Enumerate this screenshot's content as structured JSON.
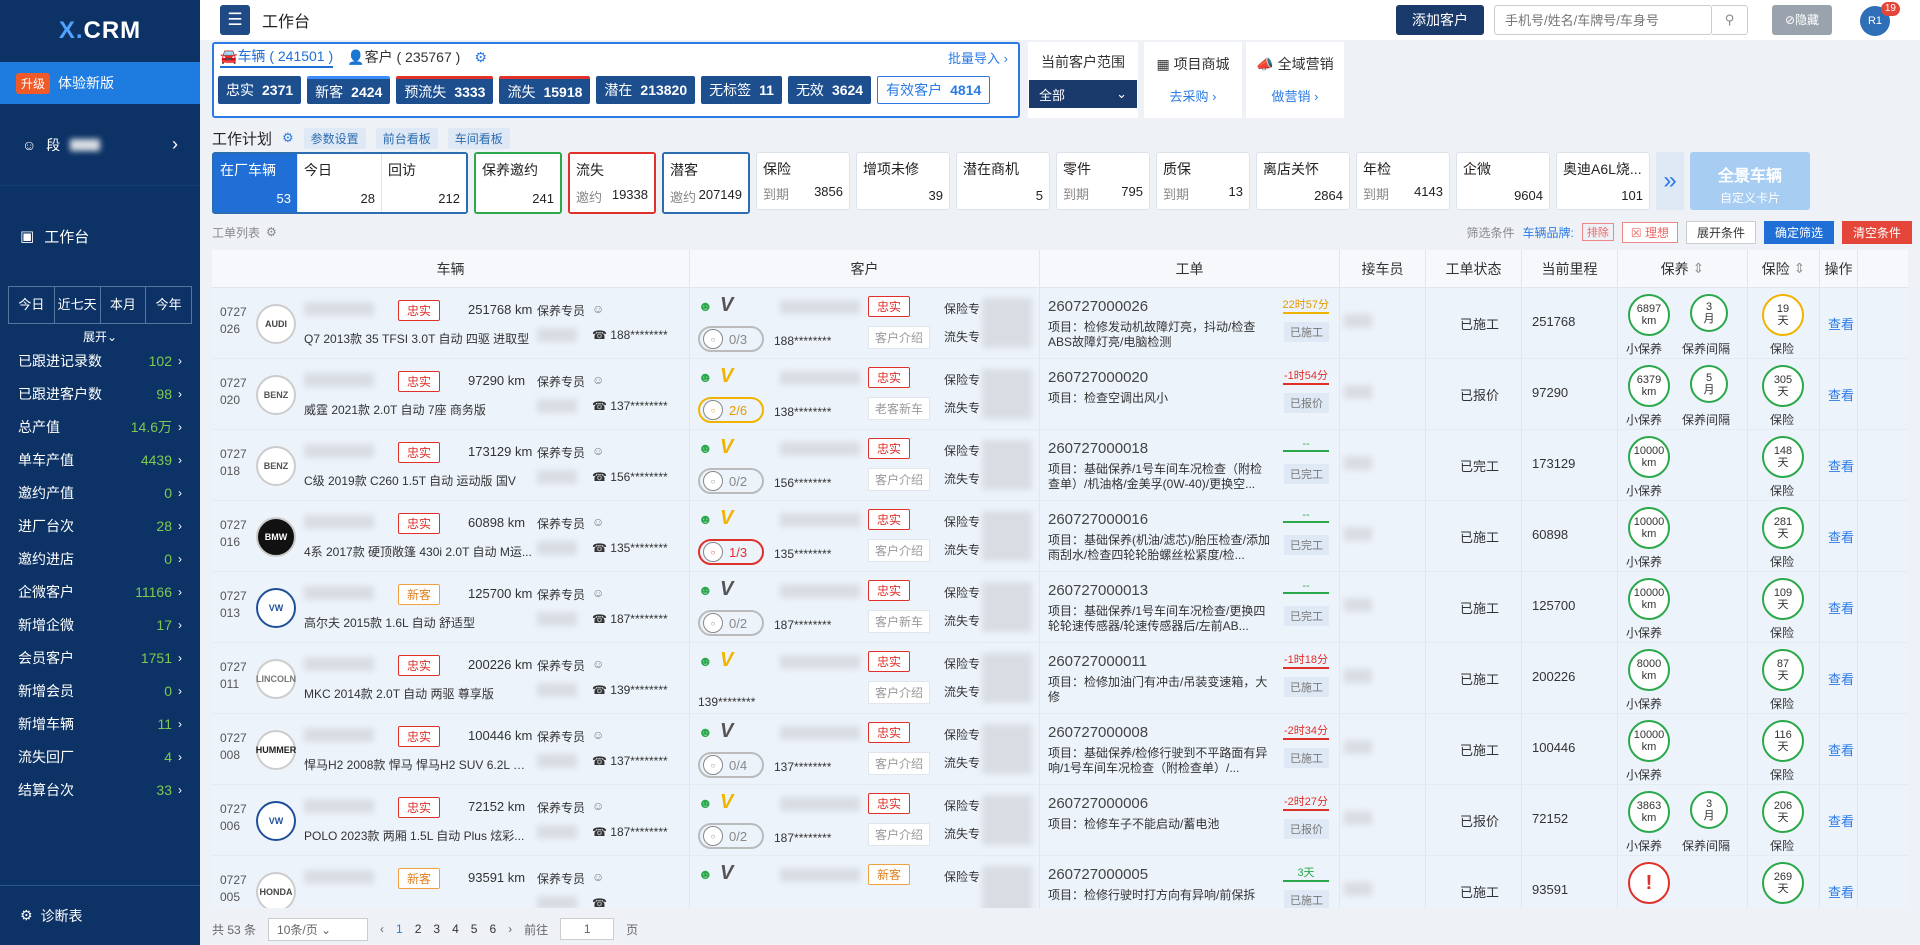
{
  "sidebar": {
    "logo_a": "X.",
    "logo_b": "CRM",
    "upgrade_tag": "升级",
    "upgrade_label": "体验新版",
    "user_name": "段",
    "workbench": "工作台",
    "periods": [
      "今日",
      "近七天",
      "本月",
      "今年"
    ],
    "expand": "展开",
    "stats": [
      {
        "label": "已跟进记录数",
        "value": "102"
      },
      {
        "label": "已跟进客户数",
        "value": "98"
      },
      {
        "label": "总产值",
        "value": "14.6万"
      },
      {
        "label": "单车产值",
        "value": "4439"
      },
      {
        "label": "邀约产值",
        "value": "0"
      },
      {
        "label": "进厂台次",
        "value": "28"
      },
      {
        "label": "邀约进店",
        "value": "0"
      },
      {
        "label": "企微客户",
        "value": "11166"
      },
      {
        "label": "新增企微",
        "value": "17"
      },
      {
        "label": "会员客户",
        "value": "1751"
      },
      {
        "label": "新增会员",
        "value": "0"
      },
      {
        "label": "新增车辆",
        "value": "11"
      },
      {
        "label": "流失回厂",
        "value": "4"
      },
      {
        "label": "结算台次",
        "value": "33"
      }
    ],
    "diagnose": "诊断表"
  },
  "header": {
    "title": "工作台",
    "add_customer": "添加客户",
    "search_placeholder": "手机号/姓名/车牌号/车身号",
    "hide": "隐藏",
    "avatar_text": "R1",
    "badge": "19"
  },
  "top_panel": {
    "tab_vehicle": "车辆 ( 241501 )",
    "tab_customer": "客户 ( 235767 )",
    "batch_import": "批量导入",
    "buttons": [
      {
        "label": "忠实",
        "value": "2371",
        "accent": "none"
      },
      {
        "label": "新客",
        "value": "2424",
        "accent": "blue"
      },
      {
        "label": "预流失",
        "value": "3333",
        "accent": "red"
      },
      {
        "label": "流失",
        "value": "15918",
        "accent": "red"
      },
      {
        "label": "潜在",
        "value": "213820",
        "accent": "none"
      },
      {
        "label": "无标签",
        "value": "11",
        "accent": "none"
      },
      {
        "label": "无效",
        "value": "3624",
        "accent": "none"
      }
    ],
    "valid_label": "有效客户",
    "valid_value": "4814"
  },
  "scope": {
    "title": "当前客户范围",
    "value": "全部"
  },
  "mall": {
    "title": "项目商城",
    "link": "去采购"
  },
  "marketing": {
    "title": "全域营销",
    "link": "做营销"
  },
  "workplan": {
    "title": "工作计划",
    "tags": [
      "参数设置",
      "前台看板",
      "车间看板"
    ]
  },
  "card_groups": [
    {
      "color": "blue",
      "cards": [
        {
          "title": "在厂车辆",
          "sub": "",
          "value": "53",
          "selected": true
        },
        {
          "title": "今日",
          "sub": "",
          "value": "28"
        },
        {
          "title": "回访",
          "sub": "",
          "value": "212"
        }
      ]
    },
    {
      "color": "green",
      "cards": [
        {
          "title": "保养邀约",
          "sub": "",
          "value": "241"
        }
      ]
    },
    {
      "color": "red",
      "cards": [
        {
          "title": "流失",
          "sub": "邀约",
          "value": "19338"
        }
      ]
    },
    {
      "color": "blue",
      "cards": [
        {
          "title": "潜客",
          "sub": "邀约",
          "value": "207149"
        }
      ]
    }
  ],
  "plain_cards": [
    {
      "title": "保险",
      "sub": "到期",
      "value": "3856"
    },
    {
      "title": "增项未修",
      "sub": "",
      "value": "39"
    },
    {
      "title": "潜在商机",
      "sub": "",
      "value": "5"
    },
    {
      "title": "零件",
      "sub": "到期",
      "value": "795"
    },
    {
      "title": "质保",
      "sub": "到期",
      "value": "13"
    },
    {
      "title": "离店关怀",
      "sub": "",
      "value": "2864"
    },
    {
      "title": "年检",
      "sub": "到期",
      "value": "4143"
    },
    {
      "title": "企微",
      "sub": "",
      "value": "9604"
    },
    {
      "title": "奥迪A6L烧...",
      "sub": "",
      "value": "101"
    }
  ],
  "full_card": {
    "title": "全景车辆",
    "sub": "自定义卡片"
  },
  "filter_row": {
    "left": "工单列表",
    "cond": "筛选条件",
    "brand": "车辆品牌:",
    "exclude": "排除",
    "ideal": "理想",
    "expand": "展开条件",
    "confirm": "确定筛选",
    "clear": "清空条件"
  },
  "table": {
    "headers": [
      "车辆",
      "客户",
      "工单",
      "接车员",
      "工单状态",
      "当前里程",
      "保养",
      "保险",
      "操作"
    ],
    "rows": [
      {
        "date": "0727",
        "seq": "026",
        "brand": "AUDI",
        "tag": "忠实",
        "km": "251768 km",
        "model": "Q7 2013款 35 TFSI 3.0T 自动 四驱 进取型",
        "adv": "保养专员",
        "phone": "188********",
        "v": "grey",
        "cnt": "0/3",
        "cntc": "",
        "ctag": "忠实",
        "csrc": "客户介绍",
        "cphone": "188********",
        "wo": "260727000026",
        "wot": "项目：检修发动机故障灯亮，抖动/检查ABS故障灯亮/电脑检测",
        "time": "22时57分",
        "timec": "o",
        "wst": "已施工",
        "st": "已施工",
        "mil": "251768",
        "b1": "6897\nkm",
        "b2": "3\n月",
        "b1c": "",
        "bl1": "小保养",
        "bl2": "保养间隔",
        "ins": "19\n天",
        "insc": "y"
      },
      {
        "date": "0727",
        "seq": "020",
        "brand": "BENZ",
        "tag": "忠实",
        "km": "97290 km",
        "model": "威霆 2021款 2.0T 自动 7座 商务版",
        "adv": "保养专员",
        "phone": "137********",
        "v": "y",
        "cnt": "2/6",
        "cntc": "y",
        "ctag": "忠实",
        "csrc": "老客新车",
        "cphone": "138********",
        "wo": "260727000020",
        "wot": "项目：检查空调出风小",
        "time": "-1时54分",
        "timec": "",
        "wst": "已报价",
        "st": "已报价",
        "mil": "97290",
        "b1": "6379\nkm",
        "b2": "5\n月",
        "b1c": "",
        "bl1": "小保养",
        "bl2": "保养间隔",
        "ins": "305\n天",
        "insc": ""
      },
      {
        "date": "0727",
        "seq": "018",
        "brand": "BENZ",
        "tag": "忠实",
        "km": "173129 km",
        "model": "C级 2019款 C260 1.5T 自动 运动版 国V",
        "adv": "保养专员",
        "phone": "156********",
        "v": "y",
        "cnt": "0/2",
        "cntc": "",
        "ctag": "忠实",
        "csrc": "客户介绍",
        "cphone": "156********",
        "wo": "260727000018",
        "wot": "项目：基础保养/1号车间车况检查（附检查单）/机油格/金美孚(0W-40)/更换空...",
        "time": "--",
        "timec": "g",
        "wst": "已完工",
        "st": "已完工",
        "mil": "173129",
        "b1": "10000\nkm",
        "b2": "",
        "b1c": "",
        "bl1": "小保养",
        "bl2": "",
        "ins": "148\n天",
        "insc": ""
      },
      {
        "date": "0727",
        "seq": "016",
        "brand": "BMW",
        "tag": "忠实",
        "km": "60898 km",
        "model": "4系 2017款 硬顶敞篷 430i 2.0T 自动 M运...",
        "adv": "保养专员",
        "phone": "135********",
        "v": "y",
        "cnt": "1/3",
        "cntc": "r",
        "ctag": "忠实",
        "csrc": "客户介绍",
        "cphone": "135********",
        "wo": "260727000016",
        "wot": "项目：基础保养(机油/滤芯)/胎压检查/添加雨刮水/检查四轮轮胎螺丝松紧度/检...",
        "time": "--",
        "timec": "g",
        "wst": "已完工",
        "st": "已施工",
        "mil": "60898",
        "b1": "10000\nkm",
        "b2": "",
        "b1c": "",
        "bl1": "小保养",
        "bl2": "",
        "ins": "281\n天",
        "insc": ""
      },
      {
        "date": "0727",
        "seq": "013",
        "brand": "VW",
        "tag": "新客",
        "km": "125700 km",
        "model": "高尔夫 2015款 1.6L 自动 舒适型",
        "adv": "保养专员",
        "phone": "187********",
        "v": "grey",
        "cnt": "0/2",
        "cntc": "",
        "ctag": "忠实",
        "csrc": "客户新车",
        "cphone": "187********",
        "wo": "260727000013",
        "wot": "项目：基础保养/1号车间车况检查/更换四轮轮速传感器/轮速传感器后/左前AB...",
        "time": "--",
        "timec": "g",
        "wst": "已完工",
        "st": "已施工",
        "mil": "125700",
        "b1": "10000\nkm",
        "b2": "",
        "b1c": "",
        "bl1": "小保养",
        "bl2": "",
        "ins": "109\n天",
        "insc": ""
      },
      {
        "date": "0727",
        "seq": "011",
        "brand": "LINCOLN",
        "tag": "忠实",
        "km": "200226 km",
        "model": "MKC 2014款 2.0T 自动 两驱 尊享版",
        "adv": "保养专员",
        "phone": "139********",
        "v": "y",
        "cnt": "",
        "cntc": "",
        "ctag": "忠实",
        "csrc": "客户介绍",
        "cphone": "139********",
        "wo": "260727000011",
        "wot": "项目：检修加油门有冲击/吊装变速箱，大修",
        "time": "-1时18分",
        "timec": "",
        "wst": "已施工",
        "st": "已施工",
        "mil": "200226",
        "b1": "8000\nkm",
        "b2": "",
        "b1c": "",
        "bl1": "小保养",
        "bl2": "",
        "ins": "87\n天",
        "insc": ""
      },
      {
        "date": "0727",
        "seq": "008",
        "brand": "HUMMER",
        "tag": "忠实",
        "km": "100446 km",
        "model": "悍马H2 2008款 悍马 悍马H2 SUV 6.2L 自...",
        "adv": "保养专员",
        "phone": "137********",
        "v": "grey",
        "cnt": "0/4",
        "cntc": "",
        "ctag": "忠实",
        "csrc": "客户介绍",
        "cphone": "137********",
        "wo": "260727000008",
        "wot": "项目：基础保养/检修行驶到不平路面有异响/1号车间车况检查（附检查单）/...",
        "time": "-2时34分",
        "timec": "",
        "wst": "已施工",
        "st": "已施工",
        "mil": "100446",
        "b1": "10000\nkm",
        "b2": "",
        "b1c": "",
        "bl1": "小保养",
        "bl2": "",
        "ins": "116\n天",
        "insc": ""
      },
      {
        "date": "0727",
        "seq": "006",
        "brand": "VW",
        "tag": "忠实",
        "km": "72152 km",
        "model": "POLO 2023款 两厢 1.5L 自动 Plus 炫彩...",
        "adv": "保养专员",
        "phone": "187********",
        "v": "y",
        "cnt": "0/2",
        "cntc": "",
        "ctag": "忠实",
        "csrc": "客户介绍",
        "cphone": "187********",
        "wo": "260727000006",
        "wot": "项目：检修车子不能启动/蓄电池",
        "time": "-2时27分",
        "timec": "",
        "wst": "已报价",
        "st": "已报价",
        "mil": "72152",
        "b1": "3863\nkm",
        "b2": "3\n月",
        "b1c": "",
        "bl1": "小保养",
        "bl2": "保养间隔",
        "ins": "206\n天",
        "insc": ""
      },
      {
        "date": "0727",
        "seq": "005",
        "brand": "HONDA",
        "tag": "新客",
        "km": "93591 km",
        "model": "",
        "adv": "保养专员",
        "phone": "",
        "v": "grey",
        "cnt": "",
        "cntc": "",
        "ctag": "新客",
        "csrc": "",
        "cphone": "",
        "wo": "260727000005",
        "wot": "项目：检修行驶时打方向有异响/前保拆",
        "time": "3天",
        "timec": "g",
        "wst": "已施工",
        "st": "已施工",
        "mil": "93591",
        "b1": "!",
        "b2": "",
        "b1c": "r",
        "bl1": "",
        "bl2": "",
        "ins": "269\n天",
        "insc": ""
      }
    ],
    "rec_mask": "",
    "plan_ins": "保险专",
    "plan_out": "流失专",
    "op": "查看",
    "ins_lbl": "保险"
  },
  "pager": {
    "total": "共 53 条",
    "size": "10条/页",
    "pages": [
      "1",
      "2",
      "3",
      "4",
      "5",
      "6"
    ],
    "goto": "前往",
    "page_input": "1",
    "page_unit": "页"
  },
  "colors": {
    "sidebar": "#0d3366",
    "accent": "#1f6fd6",
    "danger": "#e0302a",
    "ok": "#2aa84a",
    "warn": "#f0b400"
  }
}
